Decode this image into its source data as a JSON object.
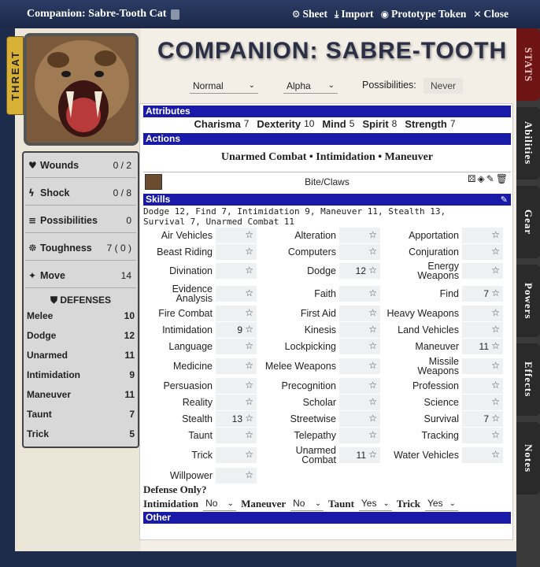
{
  "window": {
    "title": "Companion: Sabre-Tooth Cat",
    "actions": [
      {
        "icon": "gears-icon",
        "label": "Sheet"
      },
      {
        "icon": "download-icon",
        "label": "Import"
      },
      {
        "icon": "user-circle-icon",
        "label": "Prototype Token"
      },
      {
        "icon": "close-icon",
        "label": "Close"
      }
    ]
  },
  "threat_tab": "THREAT",
  "header": {
    "title": "COMPANION: SABRE-TOOTH",
    "difficulty": "Normal",
    "rank": "Alpha",
    "possibilities_label": "Possibilities:",
    "possibilities_value": "Never"
  },
  "status": {
    "wounds": {
      "label": "Wounds",
      "value": "0 / 2"
    },
    "shock": {
      "label": "Shock",
      "value": "0 / 8"
    },
    "possibilities": {
      "label": "Possibilities",
      "value": "0"
    },
    "toughness": {
      "label": "Toughness",
      "value": "7 ( 0 )"
    },
    "move": {
      "label": "Move",
      "value": "14"
    }
  },
  "defenses": {
    "header": "DEFENSES",
    "items": [
      {
        "label": "Melee",
        "value": "10"
      },
      {
        "label": "Dodge",
        "value": "12"
      },
      {
        "label": "Unarmed",
        "value": "11"
      },
      {
        "label": "Intimidation",
        "value": "9"
      },
      {
        "label": "Maneuver",
        "value": "11"
      },
      {
        "label": "Taunt",
        "value": "7"
      },
      {
        "label": "Trick",
        "value": "5"
      }
    ]
  },
  "sections": {
    "attributes": "Attributes",
    "actions": "Actions",
    "skills": "Skills",
    "other": "Other"
  },
  "attributes": [
    {
      "name": "Charisma",
      "value": "7"
    },
    {
      "name": "Dexterity",
      "value": "10"
    },
    {
      "name": "Mind",
      "value": "5"
    },
    {
      "name": "Spirit",
      "value": "8"
    },
    {
      "name": "Strength",
      "value": "7"
    }
  ],
  "actions_line": "Unarmed Combat • Intimidation • Maneuver",
  "attack": "Bite/Claws",
  "skills_summary": "Dodge 12, Find 7, Intimidation 9, Maneuver 11, Stealth 13, Survival 7, Unarmed Combat 11",
  "skills": [
    {
      "name": "Air Vehicles",
      "value": ""
    },
    {
      "name": "Alteration",
      "value": ""
    },
    {
      "name": "Apportation",
      "value": ""
    },
    {
      "name": "Beast Riding",
      "value": ""
    },
    {
      "name": "Computers",
      "value": ""
    },
    {
      "name": "Conjuration",
      "value": ""
    },
    {
      "name": "Divination",
      "value": ""
    },
    {
      "name": "Dodge",
      "value": "12"
    },
    {
      "name": "Energy Weapons",
      "value": ""
    },
    {
      "name": "Evidence Analysis",
      "value": ""
    },
    {
      "name": "Faith",
      "value": ""
    },
    {
      "name": "Find",
      "value": "7"
    },
    {
      "name": "Fire Combat",
      "value": ""
    },
    {
      "name": "First Aid",
      "value": ""
    },
    {
      "name": "Heavy Weapons",
      "value": ""
    },
    {
      "name": "Intimidation",
      "value": "9"
    },
    {
      "name": "Kinesis",
      "value": ""
    },
    {
      "name": "Land Vehicles",
      "value": ""
    },
    {
      "name": "Language",
      "value": ""
    },
    {
      "name": "Lockpicking",
      "value": ""
    },
    {
      "name": "Maneuver",
      "value": "11"
    },
    {
      "name": "Medicine",
      "value": ""
    },
    {
      "name": "Melee Weapons",
      "value": ""
    },
    {
      "name": "Missile Weapons",
      "value": ""
    },
    {
      "name": "Persuasion",
      "value": ""
    },
    {
      "name": "Precognition",
      "value": ""
    },
    {
      "name": "Profession",
      "value": ""
    },
    {
      "name": "Reality",
      "value": ""
    },
    {
      "name": "Scholar",
      "value": ""
    },
    {
      "name": "Science",
      "value": ""
    },
    {
      "name": "Stealth",
      "value": "13"
    },
    {
      "name": "Streetwise",
      "value": ""
    },
    {
      "name": "Survival",
      "value": "7"
    },
    {
      "name": "Taunt",
      "value": ""
    },
    {
      "name": "Telepathy",
      "value": ""
    },
    {
      "name": "Tracking",
      "value": ""
    },
    {
      "name": "Trick",
      "value": ""
    },
    {
      "name": "Unarmed Combat",
      "value": "11"
    },
    {
      "name": "Water Vehicles",
      "value": ""
    },
    {
      "name": "Willpower",
      "value": ""
    }
  ],
  "defense_only": {
    "label": "Defense Only?",
    "items": [
      {
        "name": "Intimidation",
        "value": "No"
      },
      {
        "name": "Maneuver",
        "value": "No"
      },
      {
        "name": "Taunt",
        "value": "Yes"
      },
      {
        "name": "Trick",
        "value": "Yes"
      }
    ]
  },
  "side_tabs": [
    "STATS",
    "Abilities",
    "Gear",
    "Powers",
    "Effects",
    "Notes"
  ],
  "colors": {
    "section_bar": "#1a1aa8",
    "active_tab": "#6e1414",
    "threat_tab": "#d9b036"
  }
}
